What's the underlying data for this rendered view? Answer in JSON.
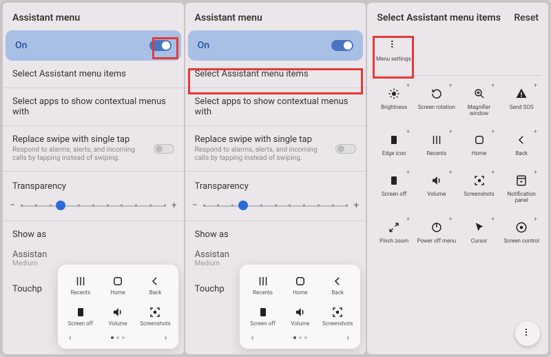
{
  "panel1": {
    "title": "Assistant menu",
    "on": "On",
    "select_items": "Select Assistant menu items",
    "select_apps": "Select apps to show contextual menus with",
    "replace_swipe": "Replace swipe with single tap",
    "replace_swipe_sub": "Respond to alarms, alerts, and incoming calls by tapping instead of swiping.",
    "transparency": "Transparency",
    "show_as": "Show as",
    "assistant": "Assistan",
    "assistant_sub": "Medium",
    "touchpad": "Touchp",
    "float_items": [
      {
        "label": "Recents",
        "icon": "recents"
      },
      {
        "label": "Home",
        "icon": "home"
      },
      {
        "label": "Back",
        "icon": "back"
      },
      {
        "label": "Screen off",
        "icon": "screenoff"
      },
      {
        "label": "Volume",
        "icon": "volume"
      },
      {
        "label": "Screenshots",
        "icon": "screenshot"
      }
    ]
  },
  "panel2": {
    "title": "Assistant menu",
    "on": "On",
    "select_items": "Select Assistant menu items",
    "select_apps": "Select apps to show contextual menus with",
    "replace_swipe": "Replace swipe with single tap",
    "replace_swipe_sub": "Respond to alarms, alerts, and incoming calls by tapping instead of swiping.",
    "transparency": "Transparency",
    "show_as": "Show as",
    "assistant": "Assistan",
    "assistant_sub": "Medium",
    "touchpad": "Touchp"
  },
  "panel3": {
    "title": "Select Assistant menu items",
    "reset": "Reset",
    "menu_settings": "Menu settings",
    "items": [
      {
        "label": "Brightness",
        "icon": "brightness"
      },
      {
        "label": "Screen rotation",
        "icon": "rotation"
      },
      {
        "label": "Magnifier window",
        "icon": "magnifier"
      },
      {
        "label": "Send SOS",
        "icon": "sos"
      },
      {
        "label": "Edge icon",
        "icon": "edge"
      },
      {
        "label": "Recents",
        "icon": "recents"
      },
      {
        "label": "Home",
        "icon": "home"
      },
      {
        "label": "Back",
        "icon": "back"
      },
      {
        "label": "Screen off",
        "icon": "screenoff"
      },
      {
        "label": "Volume",
        "icon": "volume"
      },
      {
        "label": "Screenshots",
        "icon": "screenshot"
      },
      {
        "label": "Notification panel",
        "icon": "notif"
      },
      {
        "label": "Pinch zoom",
        "icon": "pinch"
      },
      {
        "label": "Power off menu",
        "icon": "power"
      },
      {
        "label": "Cursor",
        "icon": "cursor"
      },
      {
        "label": "Screen control",
        "icon": "screenctrl"
      }
    ]
  }
}
